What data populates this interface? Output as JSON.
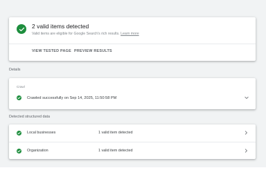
{
  "summary": {
    "title": "2 valid items detected",
    "description": "Valid items are eligible for Google Search's rich results.",
    "learn_more": "Learn more",
    "actions": {
      "view_tested_page": "VIEW TESTED PAGE",
      "preview_results": "PREVIEW RESULTS"
    }
  },
  "details": {
    "section_label": "Details",
    "crawl": {
      "caption": "Crawl",
      "status": "Crawled successfully on Sep 14, 2025, 11:50:58 PM"
    }
  },
  "structured_data": {
    "section_label": "Detected structured data",
    "items": [
      {
        "name": "Local businesses",
        "count": "1 valid item detected"
      },
      {
        "name": "Organization",
        "count": "1 valid item detected"
      }
    ]
  },
  "colors": {
    "success": "#1e8e3e",
    "background": "#f1f3f4"
  },
  "icons": {
    "status": "check-circle-icon",
    "expand": "chevron-down-icon",
    "open": "chevron-right-icon"
  }
}
